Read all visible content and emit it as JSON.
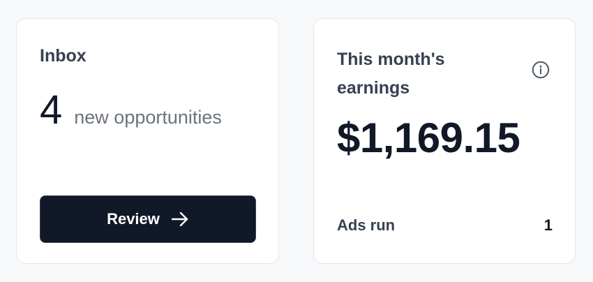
{
  "inbox": {
    "title": "Inbox",
    "count": "4",
    "count_label": "new opportunities",
    "review_button_label": "Review"
  },
  "earnings": {
    "title": "This month's earnings",
    "amount": "$1,169.15",
    "info_icon": "info-circle",
    "stats": [
      {
        "label": "Ads run",
        "value": "1"
      }
    ]
  },
  "colors": {
    "background": "#f7f8fa",
    "card": "#ffffff",
    "card_border": "#e5e7eb",
    "button_bg": "#111827",
    "text_primary": "#111827",
    "text_heading": "#374151",
    "text_muted": "#6b7280"
  }
}
